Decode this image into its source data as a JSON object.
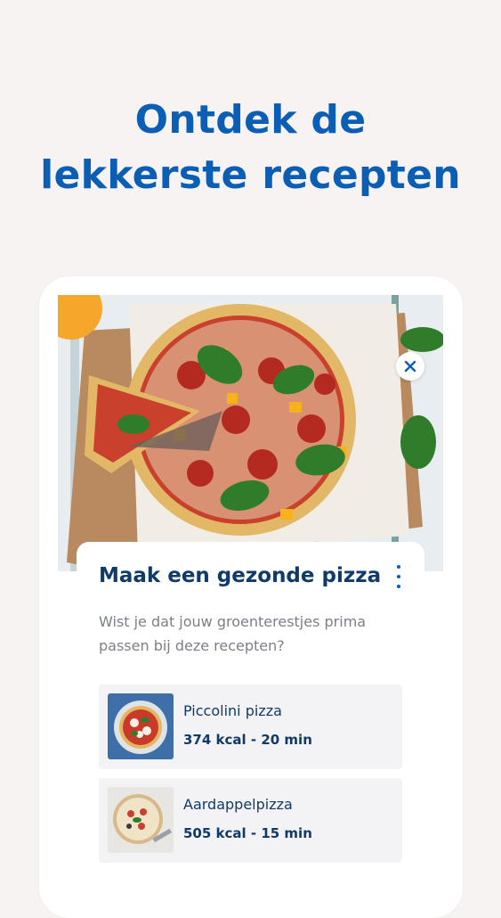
{
  "headline": {
    "line1": "Ontdek de",
    "line2": "lekkerste recepten"
  },
  "card": {
    "title": "Maak een gezonde pizza",
    "description": "Wist je dat jouw groenterestjes prima passen bij deze recepten?",
    "close_icon": "close-icon",
    "more_icon": "more-vertical-icon"
  },
  "recipes": [
    {
      "name": "Piccolini pizza",
      "meta": "374 kcal - 20 min"
    },
    {
      "name": "Aardappelpizza",
      "meta": "505 kcal - 15 min"
    }
  ],
  "colors": {
    "brand_blue": "#0a5fb4",
    "navy_text": "#103a67",
    "background": "#f7f3f2"
  }
}
